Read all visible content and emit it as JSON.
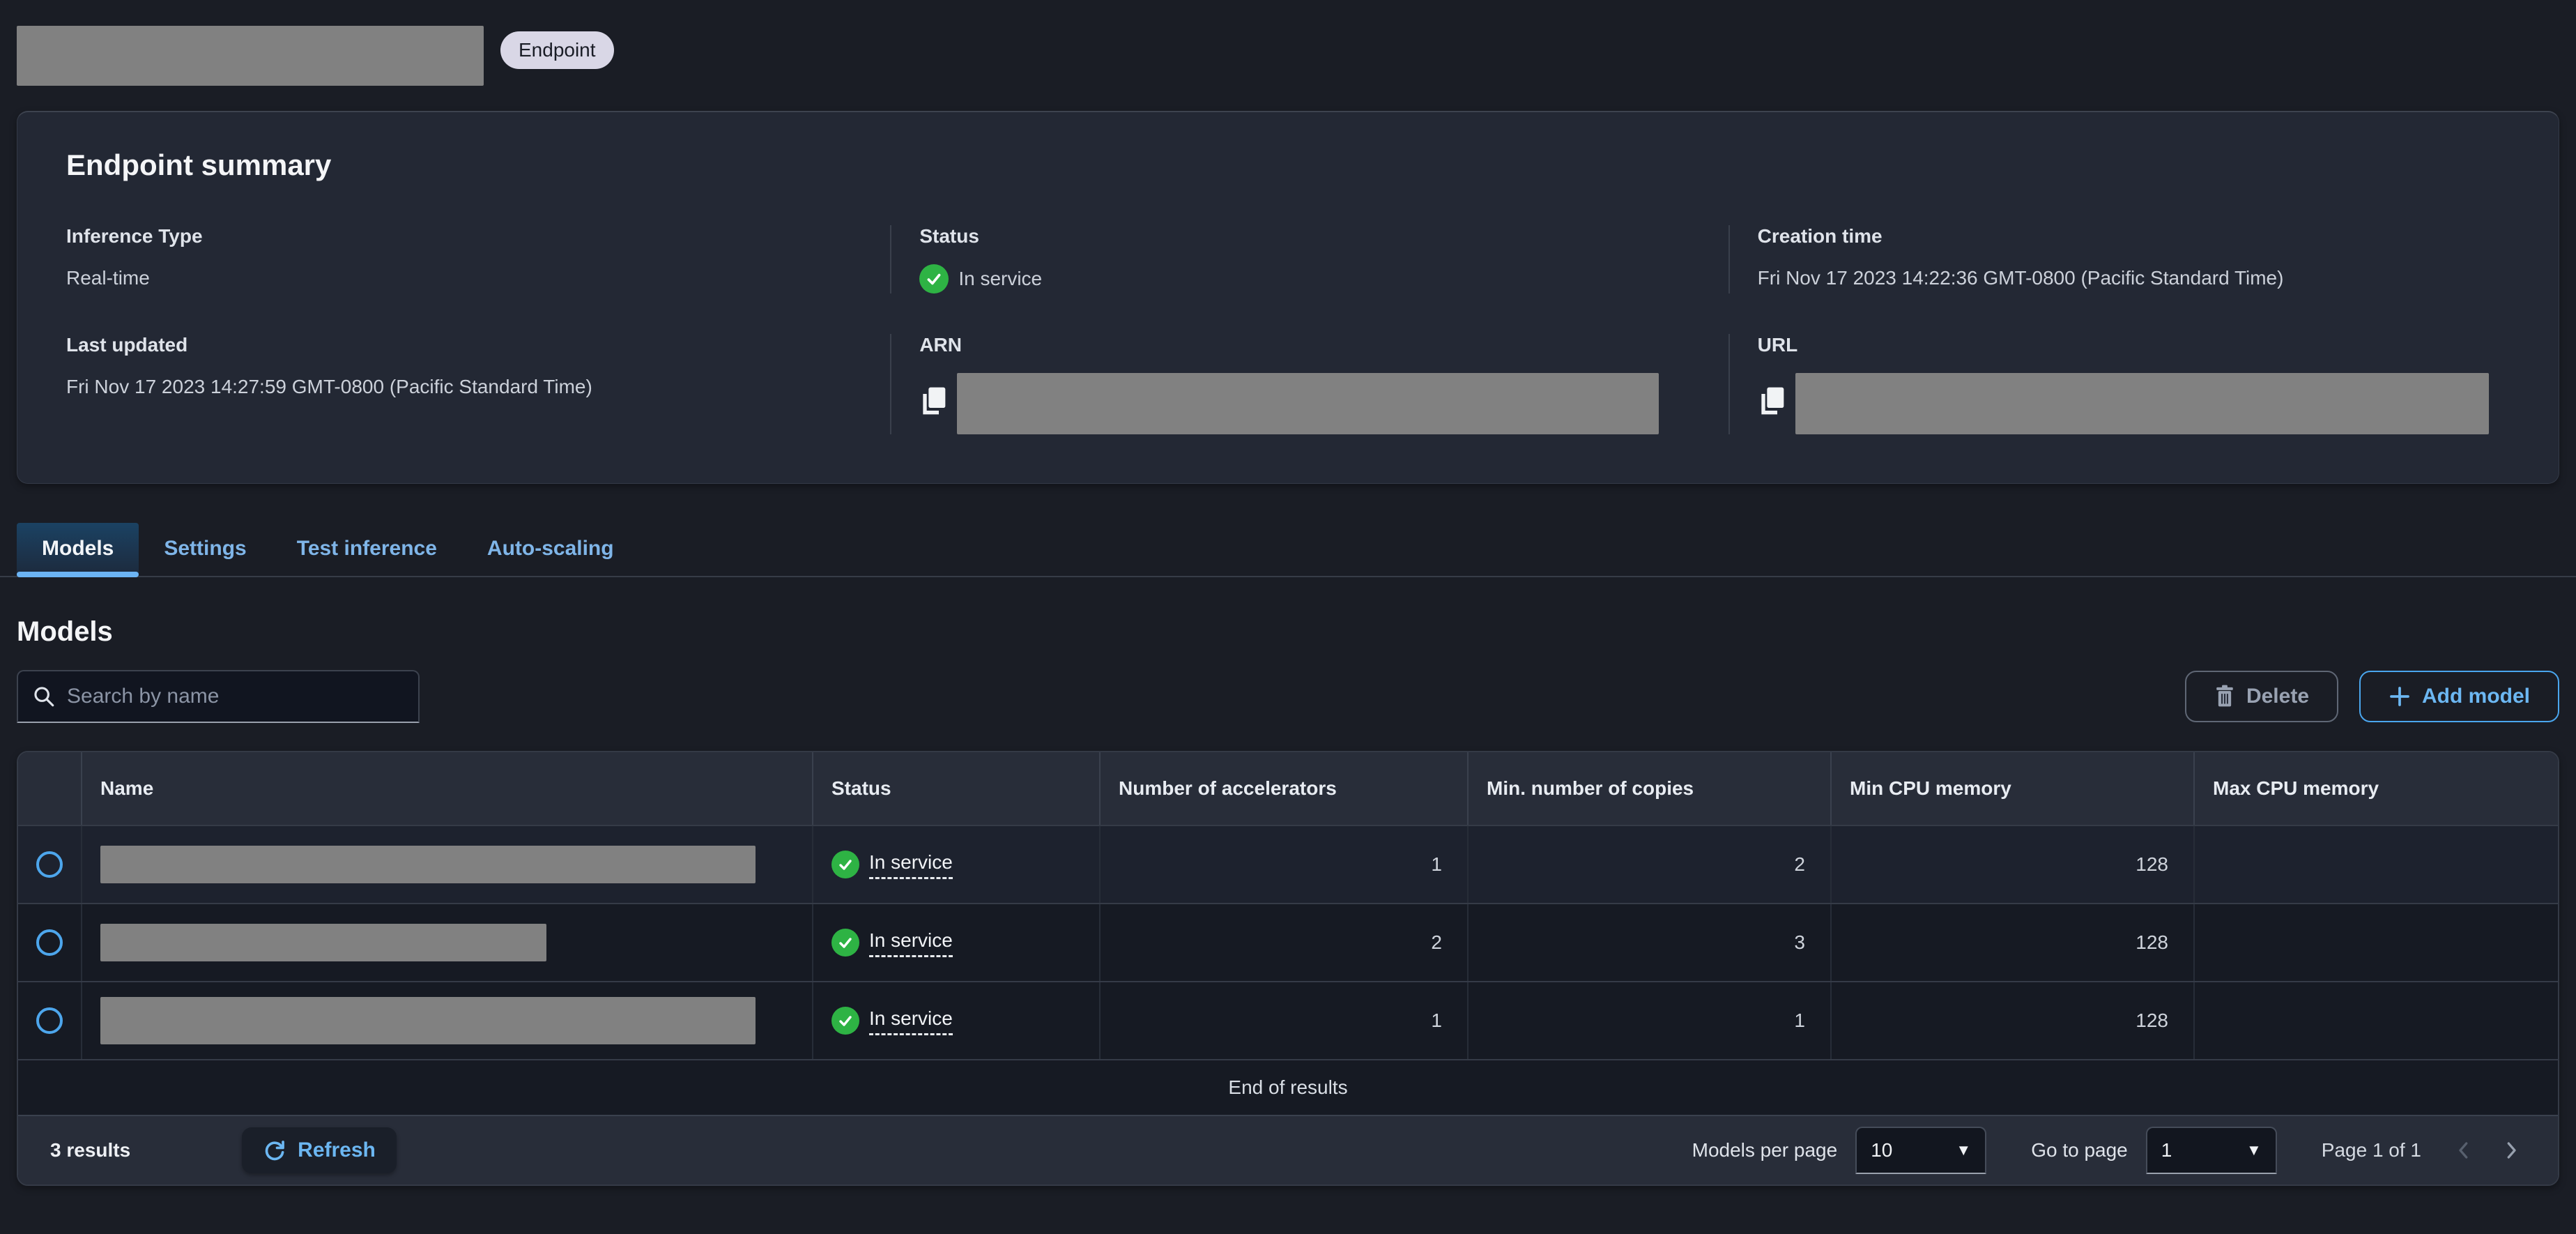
{
  "header": {
    "badge_label": "Endpoint"
  },
  "summary": {
    "title": "Endpoint summary",
    "inference_type": {
      "label": "Inference Type",
      "value": "Real-time"
    },
    "status": {
      "label": "Status",
      "value": "In service"
    },
    "creation_time": {
      "label": "Creation time",
      "value": "Fri Nov 17 2023 14:22:36 GMT-0800 (Pacific Standard Time)"
    },
    "last_updated": {
      "label": "Last updated",
      "value": "Fri Nov 17 2023 14:27:59 GMT-0800 (Pacific Standard Time)"
    },
    "arn": {
      "label": "ARN"
    },
    "url": {
      "label": "URL"
    }
  },
  "tabs": {
    "items": [
      {
        "label": "Models",
        "active": true
      },
      {
        "label": "Settings",
        "active": false
      },
      {
        "label": "Test inference",
        "active": false
      },
      {
        "label": "Auto-scaling",
        "active": false
      }
    ]
  },
  "models": {
    "heading": "Models",
    "search_placeholder": "Search by name",
    "delete_label": "Delete",
    "add_label": "Add model",
    "table": {
      "columns": [
        "Name",
        "Status",
        "Number of accelerators",
        "Min. number of copies",
        "Min CPU memory",
        "Max CPU memory"
      ],
      "rows": [
        {
          "status": "In service",
          "accelerators": "1",
          "min_copies": "2",
          "min_cpu": "128",
          "max_cpu": ""
        },
        {
          "status": "In service",
          "accelerators": "2",
          "min_copies": "3",
          "min_cpu": "128",
          "max_cpu": ""
        },
        {
          "status": "In service",
          "accelerators": "1",
          "min_copies": "1",
          "min_cpu": "128",
          "max_cpu": ""
        }
      ],
      "end_text": "End of results"
    },
    "footer": {
      "results_text": "3 results",
      "refresh_label": "Refresh",
      "per_page_label": "Models per page",
      "per_page_value": "10",
      "goto_label": "Go to page",
      "goto_value": "1",
      "page_text": "Page 1 of 1"
    }
  },
  "icons": {
    "caret_down": "▼",
    "plus": "+",
    "check": "✓",
    "search": "magnifier",
    "copy": "two-pages",
    "trash": "trash-can",
    "refresh": "circular-arrow",
    "chevron_left": "‹",
    "chevron_right": "›"
  },
  "colors": {
    "accent_blue": "#6cb4f4",
    "status_green": "#2eb344",
    "badge_bg": "#d9d7e6",
    "redaction_gray": "#818181",
    "panel_bg": "#232834",
    "page_bg": "#1a1d25"
  }
}
